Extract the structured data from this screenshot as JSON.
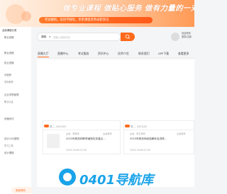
{
  "banner": {
    "title": "做专业课程 做贴心服务 做有力量的一对一",
    "pill_text": "考试顺利，培训不踩坑，享系课程老师录影资讯"
  },
  "sidebar": {
    "header": "全部课程分类",
    "items": [
      {
        "label": "职业资格"
      },
      {
        "label": "职业资格"
      },
      {
        "label": "执业资格"
      },
      {
        "label": "中医药"
      },
      {
        "label": "学历教育"
      },
      {
        "label": "企业学院管理"
      },
      {
        "label": "职业认证"
      },
      {
        "label": "资格考试"
      },
      {
        "label": "设计CAD建筑"
      },
      {
        "label": "学习工具"
      },
      {
        "label": "设计课程"
      }
    ]
  },
  "search": {
    "category": "课程",
    "placeholder": "请输入搜索内容"
  },
  "login": {
    "line1": "欢迎来到",
    "line2": "登录/注册"
  },
  "nav": {
    "tabs": [
      {
        "label": "直播大厅"
      },
      {
        "label": "直播中心"
      },
      {
        "label": "考试服务"
      },
      {
        "label": "资讯中心"
      },
      {
        "label": "优师介绍"
      },
      {
        "label": "联系我们"
      },
      {
        "label": "APP下载"
      },
      {
        "label": "查看更多"
      }
    ]
  },
  "cards": [
    {
      "date": "周二, 2023/03",
      "line1": "主讲：李老师",
      "line2": "主讲老师",
      "title": "2023年税务师职称面授实务重点…",
      "time": "10:01 20:00-21:30"
    },
    {
      "date": "周二, 2023/03",
      "line1": "主讲：李王老师",
      "line2": "主讲老师",
      "title": "2023年税务师经验解析及进修…",
      "time": "10:01 20:00-21:30"
    }
  ],
  "watermark": {
    "text": "0401导航库"
  },
  "footer": {
    "label": "免费咨询"
  }
}
